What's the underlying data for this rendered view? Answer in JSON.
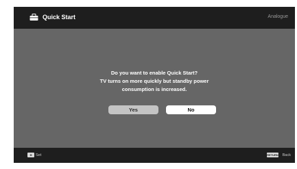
{
  "header": {
    "title": "Quick Start",
    "title_icon": "tv-toolbox-icon",
    "input_label": "Analogue"
  },
  "dialog": {
    "lines": [
      "Do you want to enable Quick Start?",
      "TV turns on more quickly but standby power",
      "consumption is increased."
    ],
    "yes_label": "Yes",
    "no_label": "No",
    "focused_button": "Yes"
  },
  "footer": {
    "set_key_icon": "enter-key-icon",
    "set_key_text": "⊕",
    "set_label": "Set",
    "back_key_icon": "return-key-icon",
    "back_key_text": "RETURN",
    "back_label": "Back"
  },
  "colors": {
    "background": "#666666",
    "bar": "#1e1e1e",
    "text": "#ffffff",
    "focused_button": "#c4c4c4",
    "button": "#ffffff"
  }
}
